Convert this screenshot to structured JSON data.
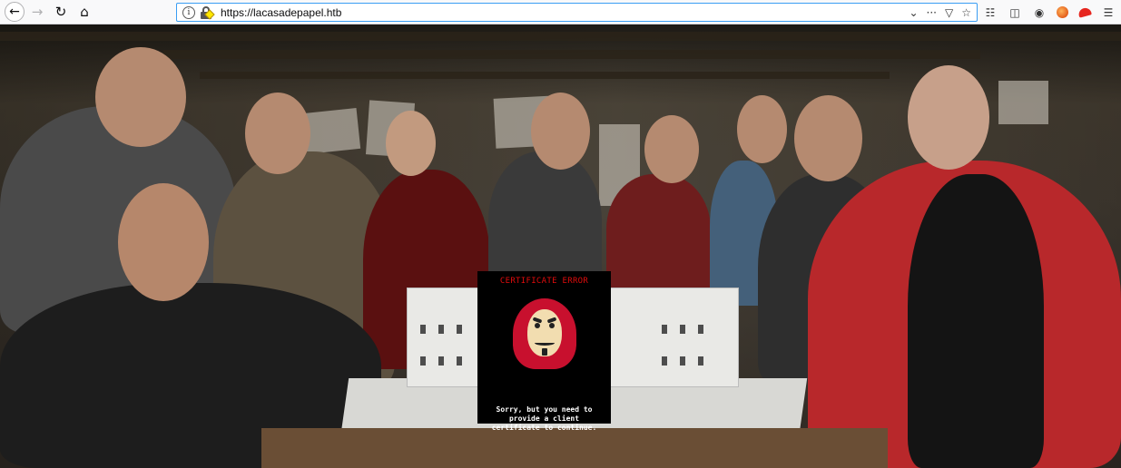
{
  "browser": {
    "url": "https://lacasadepapel.htb",
    "icons": {
      "back": "back-arrow-icon",
      "forward": "forward-arrow-icon",
      "reload": "reload-icon",
      "home": "home-icon",
      "info": "info-icon",
      "lock": "insecure-lock-icon",
      "dropdown": "chevron-down-icon",
      "more": "more-dots-icon",
      "pocket": "pocket-icon",
      "bookmark": "star-icon",
      "library": "library-icon",
      "sidebar": "sidebar-icon",
      "ext1": "extension-icon",
      "ext2": "extension-icon",
      "menu": "hamburger-menu-icon"
    }
  },
  "page": {
    "certificate_error": {
      "title": "CERTIFICATE ERROR",
      "message": "Sorry, but you need to provide a client certificate to continue.",
      "image": "dali-mask-icon"
    }
  },
  "colors": {
    "error_title": "#e10c0c",
    "card_bg": "#000000",
    "urlbar_focus": "#3a9df3"
  }
}
